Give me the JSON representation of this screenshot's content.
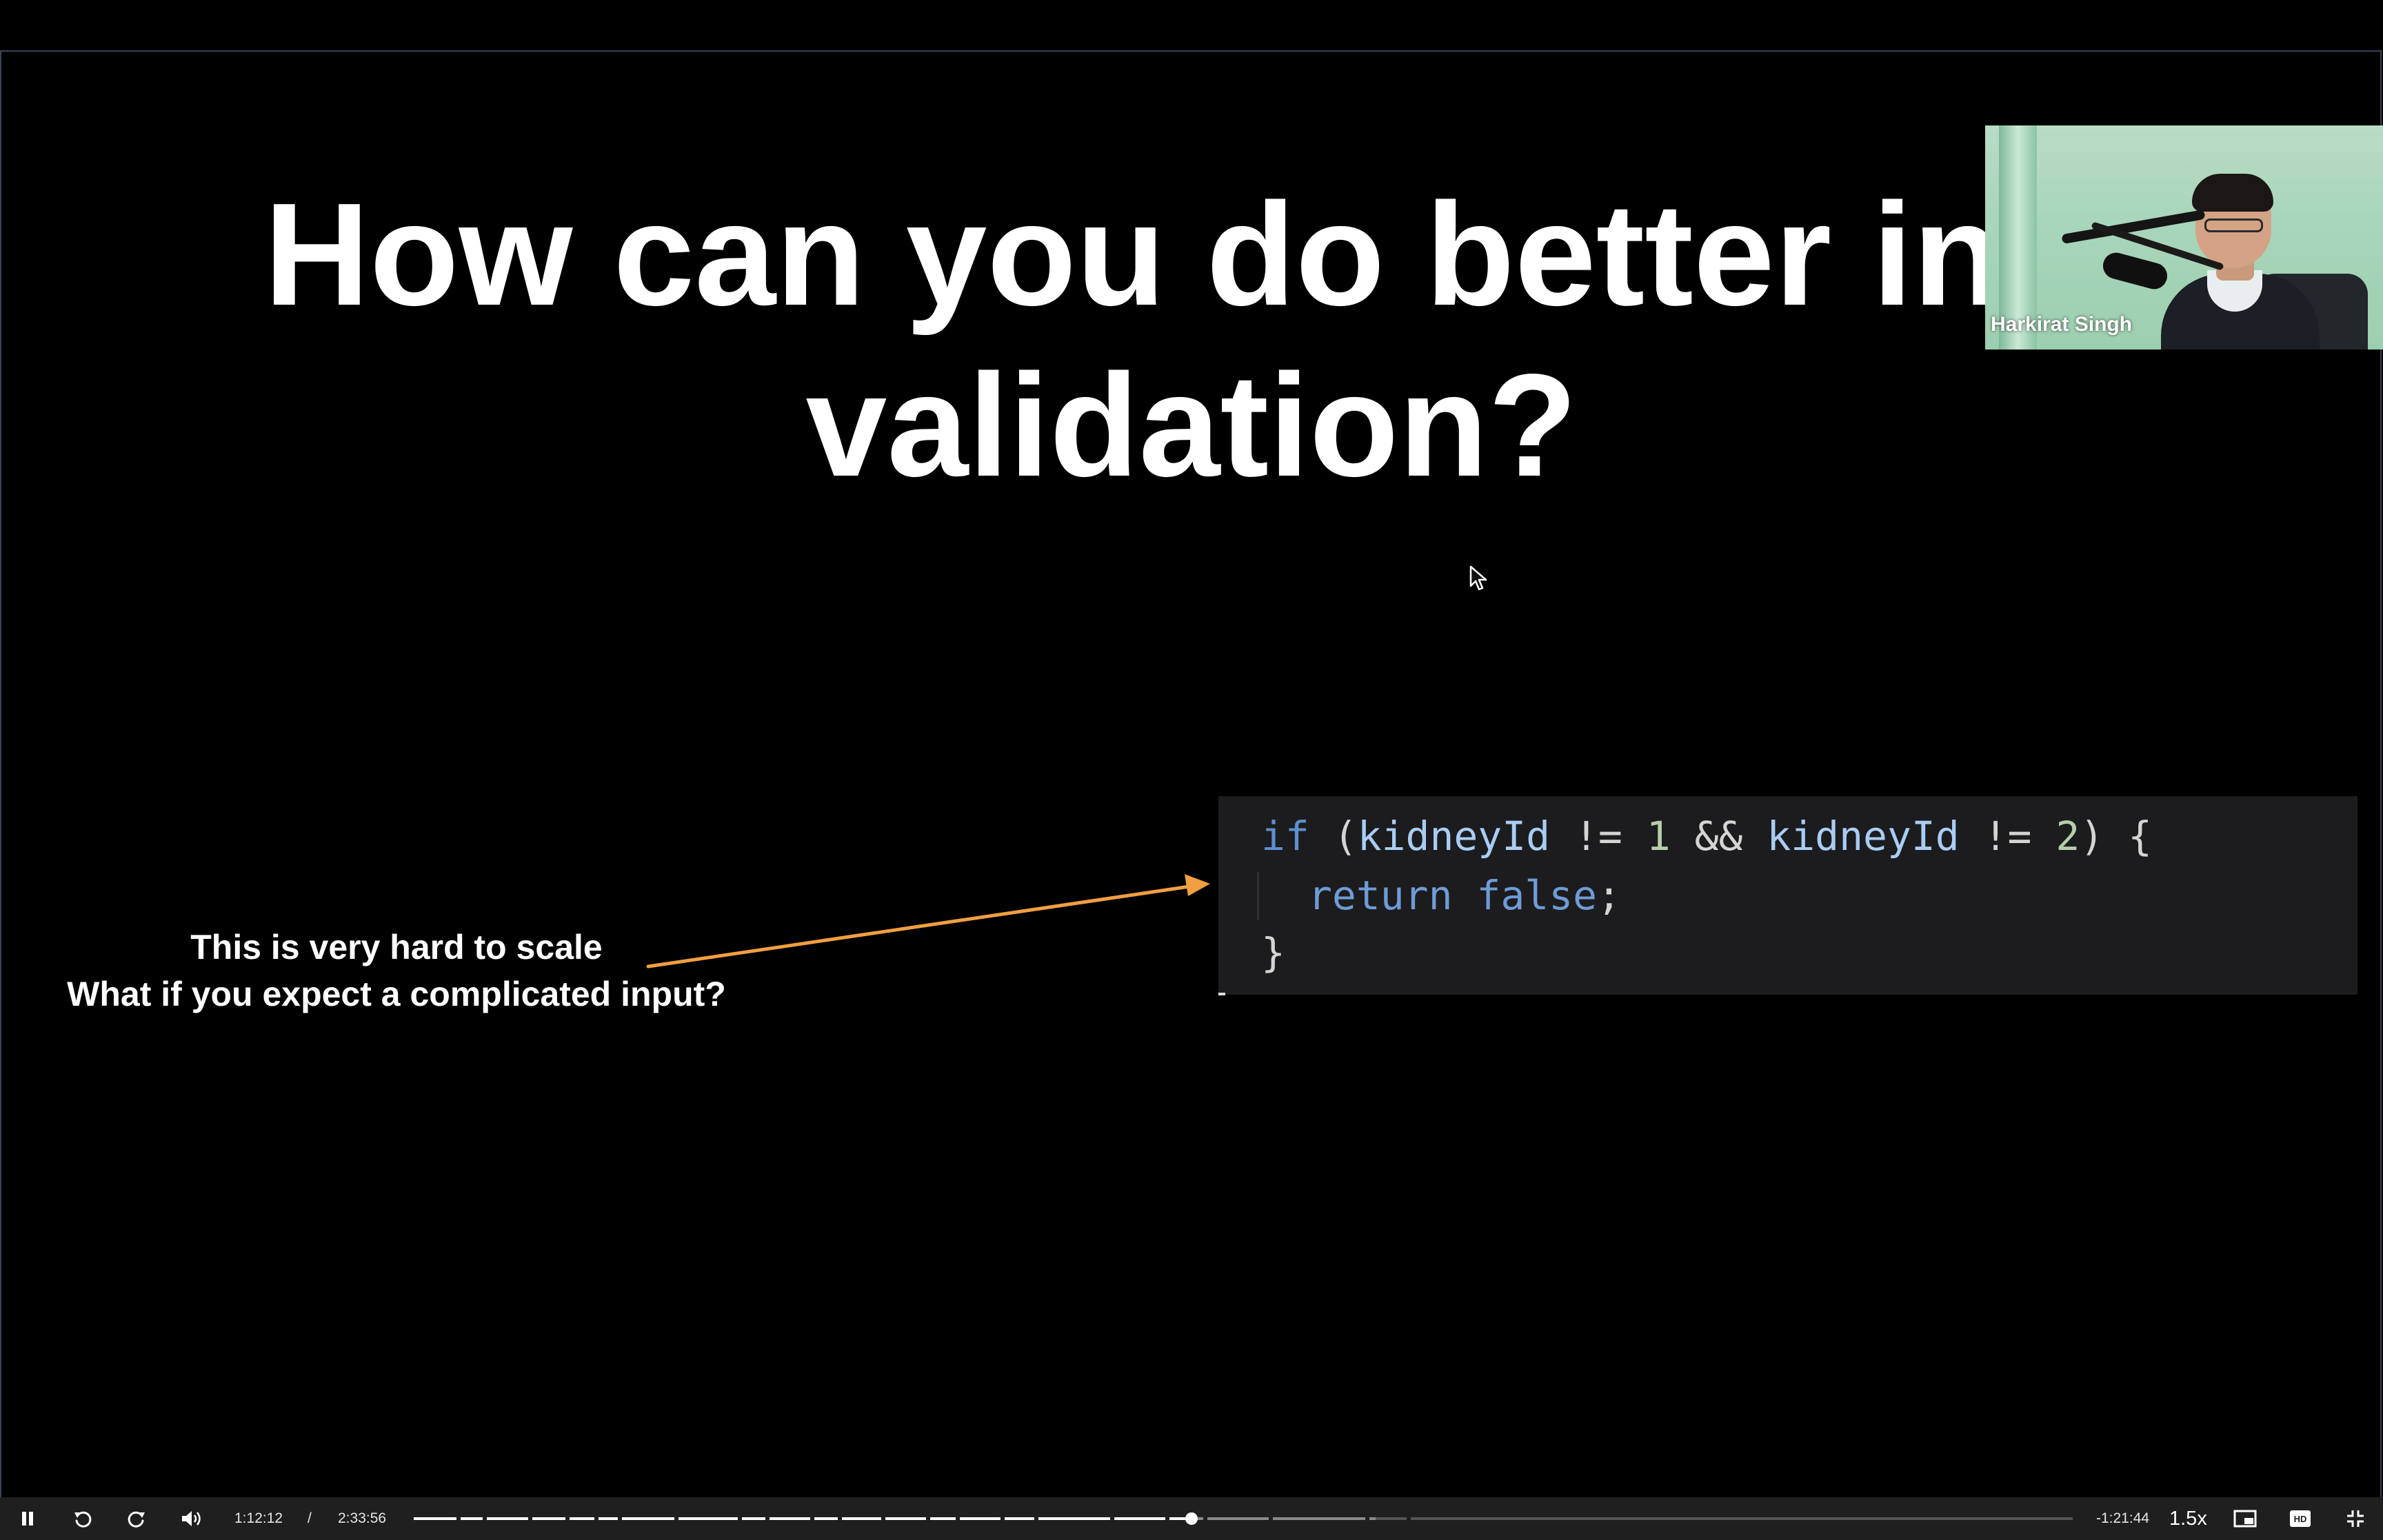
{
  "slide": {
    "title_line1": "How can you do better inp",
    "title_line2": "validation?",
    "annotation_line1": "This is very hard to scale",
    "annotation_line2": "What if you expect a complicated input?",
    "arrow_color": "#f0a040"
  },
  "code": {
    "line1": {
      "kw_if": "if",
      "part_a": " (",
      "ident_1": "kidneyId",
      "part_b": " != ",
      "num_1": "1",
      "part_c": " && ",
      "ident_2": "kidneyId",
      "part_d": " != ",
      "num_2": "2",
      "part_e": ") {"
    },
    "line2": {
      "kw_return": "return",
      "space": " ",
      "kw_false": "false",
      "semicolon": ";"
    },
    "line3": "}"
  },
  "webcam": {
    "participant_name": "Harkirat Singh"
  },
  "player": {
    "current_time": "1:12:12",
    "separator": "/",
    "duration": "2:33:56",
    "remaining": "-1:21:44",
    "speed": "1.5x",
    "progress_fraction": 0.469,
    "buffered_fraction": 0.58,
    "icons": {
      "play_pause": "pause-icon",
      "rewind": "rewind-icon",
      "forward": "forward-icon",
      "volume": "volume-icon",
      "pip": "picture-in-picture-icon",
      "hd": "hd-icon",
      "fullscreen": "exit-fullscreen-icon"
    }
  },
  "colors": {
    "background": "#000000",
    "controls_bar": "#1f1f1f",
    "code_bg": "#1c1c1e",
    "keyword": "#5d8fd0",
    "identifier": "#a9cdf4"
  }
}
